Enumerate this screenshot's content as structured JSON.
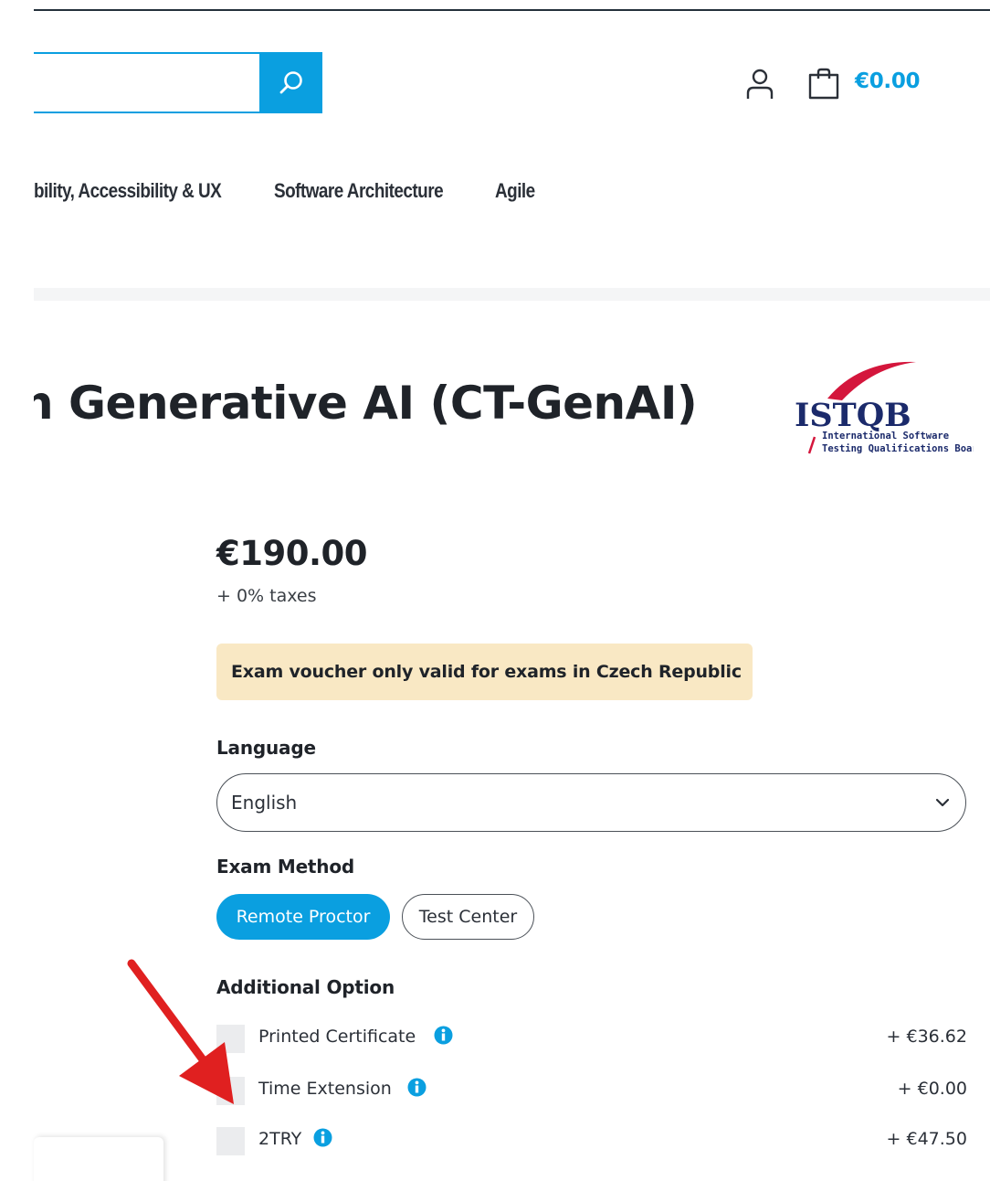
{
  "header": {
    "search_placeholder": "",
    "cart_total": "€0.00"
  },
  "nav": {
    "items": [
      {
        "label": "bility, Accessibility & UX"
      },
      {
        "label": "Software Architecture"
      },
      {
        "label": "Agile"
      }
    ]
  },
  "product": {
    "title": "h Generative AI (CT-GenAI)",
    "logo": {
      "text": "ISTQB",
      "line1": "International Software",
      "line2": "Testing Qualifications Board"
    },
    "price": "€190.00",
    "taxes": "+ 0% taxes",
    "notice": "Exam voucher only valid for exams in Czech Republic"
  },
  "language": {
    "label": "Language",
    "selected": "English"
  },
  "exam_method": {
    "label": "Exam Method",
    "options": [
      {
        "label": "Remote Proctor",
        "active": true
      },
      {
        "label": "Test Center",
        "active": false
      }
    ]
  },
  "additional": {
    "label": "Additional Option",
    "options": [
      {
        "label": "Printed Certificate",
        "price": "+ €36.62"
      },
      {
        "label": "Time Extension",
        "price": "+ €0.00"
      },
      {
        "label": "2TRY",
        "price": "+ €47.50"
      }
    ]
  },
  "colors": {
    "accent": "#0a9fe0",
    "notice_bg": "#f9e8c4",
    "arrow": "#e02020",
    "logo_red": "#d4163c",
    "logo_navy": "#1b2a6b"
  }
}
